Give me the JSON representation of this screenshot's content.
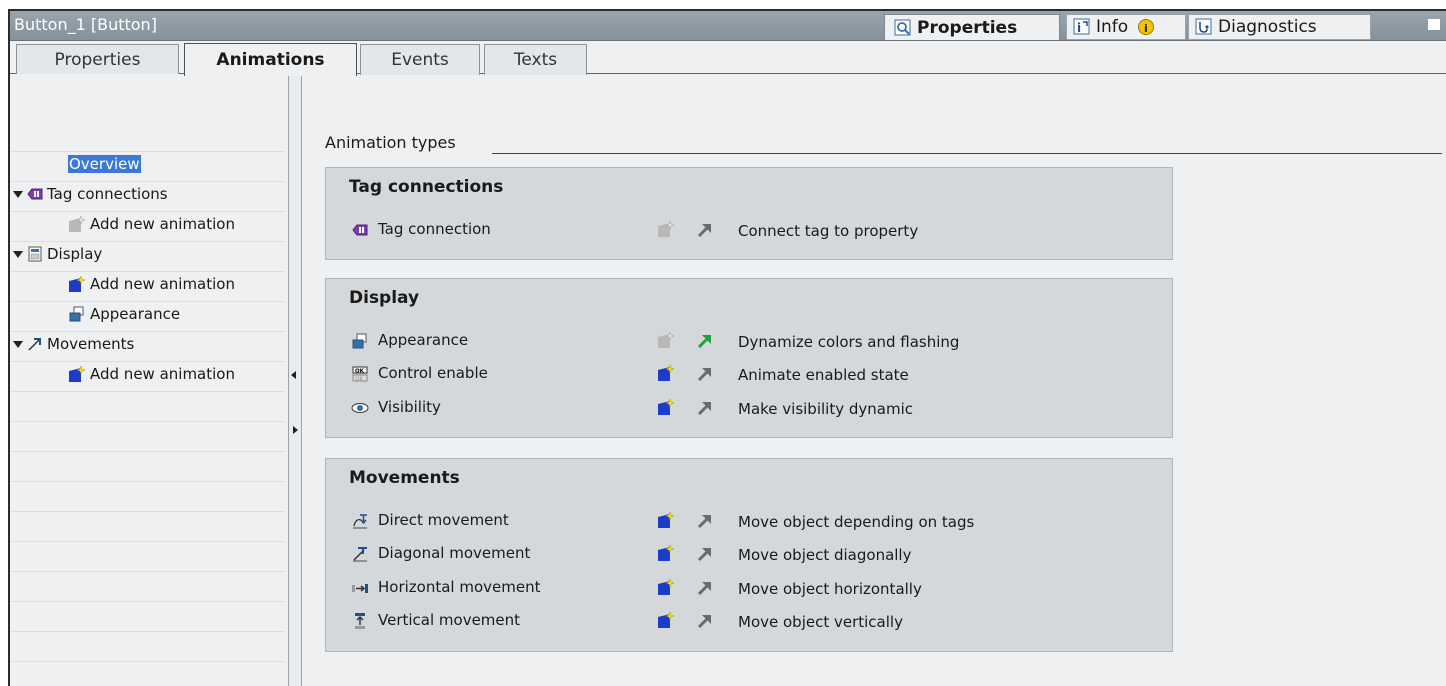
{
  "window": {
    "title": "Button_1 [Button]"
  },
  "top_tabs": {
    "properties": "Properties",
    "info": "Info",
    "diagnostics": "Diagnostics"
  },
  "sub_tabs": [
    "Properties",
    "Animations",
    "Events",
    "Texts"
  ],
  "tree": {
    "overview": "Overview",
    "tag_connections": "Tag connections",
    "display": "Display",
    "movements": "Movements",
    "add_new": "Add new animation",
    "appearance": "Appearance"
  },
  "main": {
    "section_title": "Animation types",
    "groups": [
      {
        "title": "Tag connections",
        "items": [
          {
            "icon": "tag-connection-icon",
            "name": "Tag connection",
            "desc": "Connect tag to property",
            "enabled": false,
            "active": false
          }
        ]
      },
      {
        "title": "Display",
        "items": [
          {
            "icon": "appearance-icon",
            "name": "Appearance",
            "desc": "Dynamize colors and flashing",
            "enabled": false,
            "active": true
          },
          {
            "icon": "control-enable-icon",
            "name": "Control enable",
            "desc": "Animate enabled state",
            "enabled": true,
            "active": false
          },
          {
            "icon": "eye-icon",
            "name": "Visibility",
            "desc": "Make visibility dynamic",
            "enabled": true,
            "active": false
          }
        ]
      },
      {
        "title": "Movements",
        "items": [
          {
            "icon": "direct-movement-icon",
            "name": "Direct movement",
            "desc": "Move object depending on tags",
            "enabled": true,
            "active": false
          },
          {
            "icon": "diagonal-movement-icon",
            "name": "Diagonal movement",
            "desc": "Move object diagonally",
            "enabled": true,
            "active": false
          },
          {
            "icon": "horizontal-movement-icon",
            "name": "Horizontal movement",
            "desc": "Move object horizontally",
            "enabled": true,
            "active": false
          },
          {
            "icon": "vertical-movement-icon",
            "name": "Vertical movement",
            "desc": "Move object vertically",
            "enabled": true,
            "active": false
          }
        ]
      }
    ]
  },
  "colors": {
    "selection": "#3b78d8",
    "active_arrow": "#1ea33a",
    "inactive_arrow": "#6a6a6a",
    "group_bg": "#d5d8da"
  }
}
